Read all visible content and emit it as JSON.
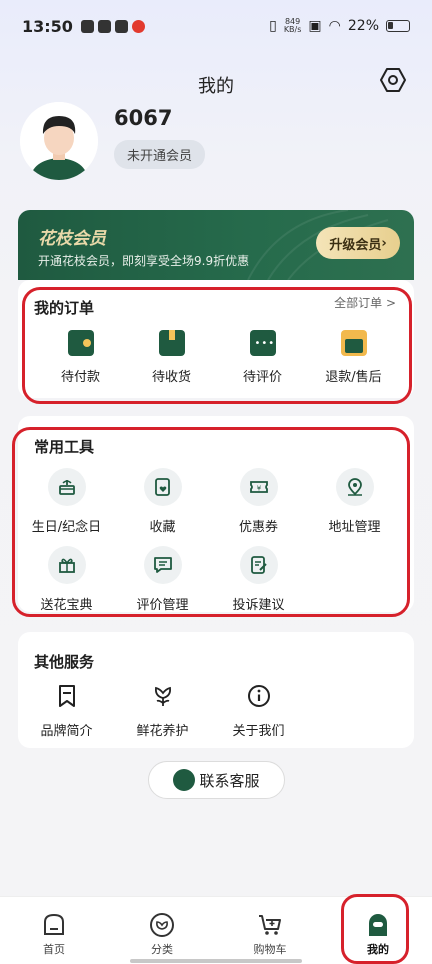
{
  "status_bar": {
    "time": "13:50",
    "net_speed_value": "849",
    "net_speed_unit": "KB/s",
    "battery": "22%"
  },
  "header": {
    "title": "我的"
  },
  "profile": {
    "username": "6067",
    "member_status": "未开通会员"
  },
  "vip": {
    "title": "花枝会员",
    "description": "开通花枝会员，即刻享受全场9.9折优惠",
    "button": "升级会员"
  },
  "orders": {
    "title": "我的订单",
    "all_link": "全部订单",
    "items": [
      {
        "label": "待付款",
        "icon": "wallet-icon"
      },
      {
        "label": "待收货",
        "icon": "package-icon"
      },
      {
        "label": "待评价",
        "icon": "comment-icon"
      },
      {
        "label": "退款/售后",
        "icon": "refund-icon"
      }
    ]
  },
  "tools": {
    "title": "常用工具",
    "items": [
      {
        "label": "生日/纪念日",
        "icon": "cake-icon"
      },
      {
        "label": "收藏",
        "icon": "favorite-icon"
      },
      {
        "label": "优惠券",
        "icon": "coupon-icon"
      },
      {
        "label": "地址管理",
        "icon": "location-icon"
      },
      {
        "label": "送花宝典",
        "icon": "book-icon"
      },
      {
        "label": "评价管理",
        "icon": "message-icon"
      },
      {
        "label": "投诉建议",
        "icon": "feedback-icon"
      }
    ]
  },
  "other": {
    "title": "其他服务",
    "items": [
      {
        "label": "品牌简介",
        "icon": "bookmark-icon"
      },
      {
        "label": "鲜花养护",
        "icon": "flower-icon"
      },
      {
        "label": "关于我们",
        "icon": "info-icon"
      }
    ]
  },
  "customer_service": {
    "label": "联系客服"
  },
  "tabbar": {
    "items": [
      {
        "label": "首页",
        "icon": "home-icon"
      },
      {
        "label": "分类",
        "icon": "category-icon"
      },
      {
        "label": "购物车",
        "icon": "cart-icon"
      },
      {
        "label": "我的",
        "icon": "profile-icon",
        "active": true
      }
    ]
  },
  "colors": {
    "brand_green": "#1f5a40",
    "gold": "#e7cf8e",
    "highlight_red": "#d6212b"
  }
}
